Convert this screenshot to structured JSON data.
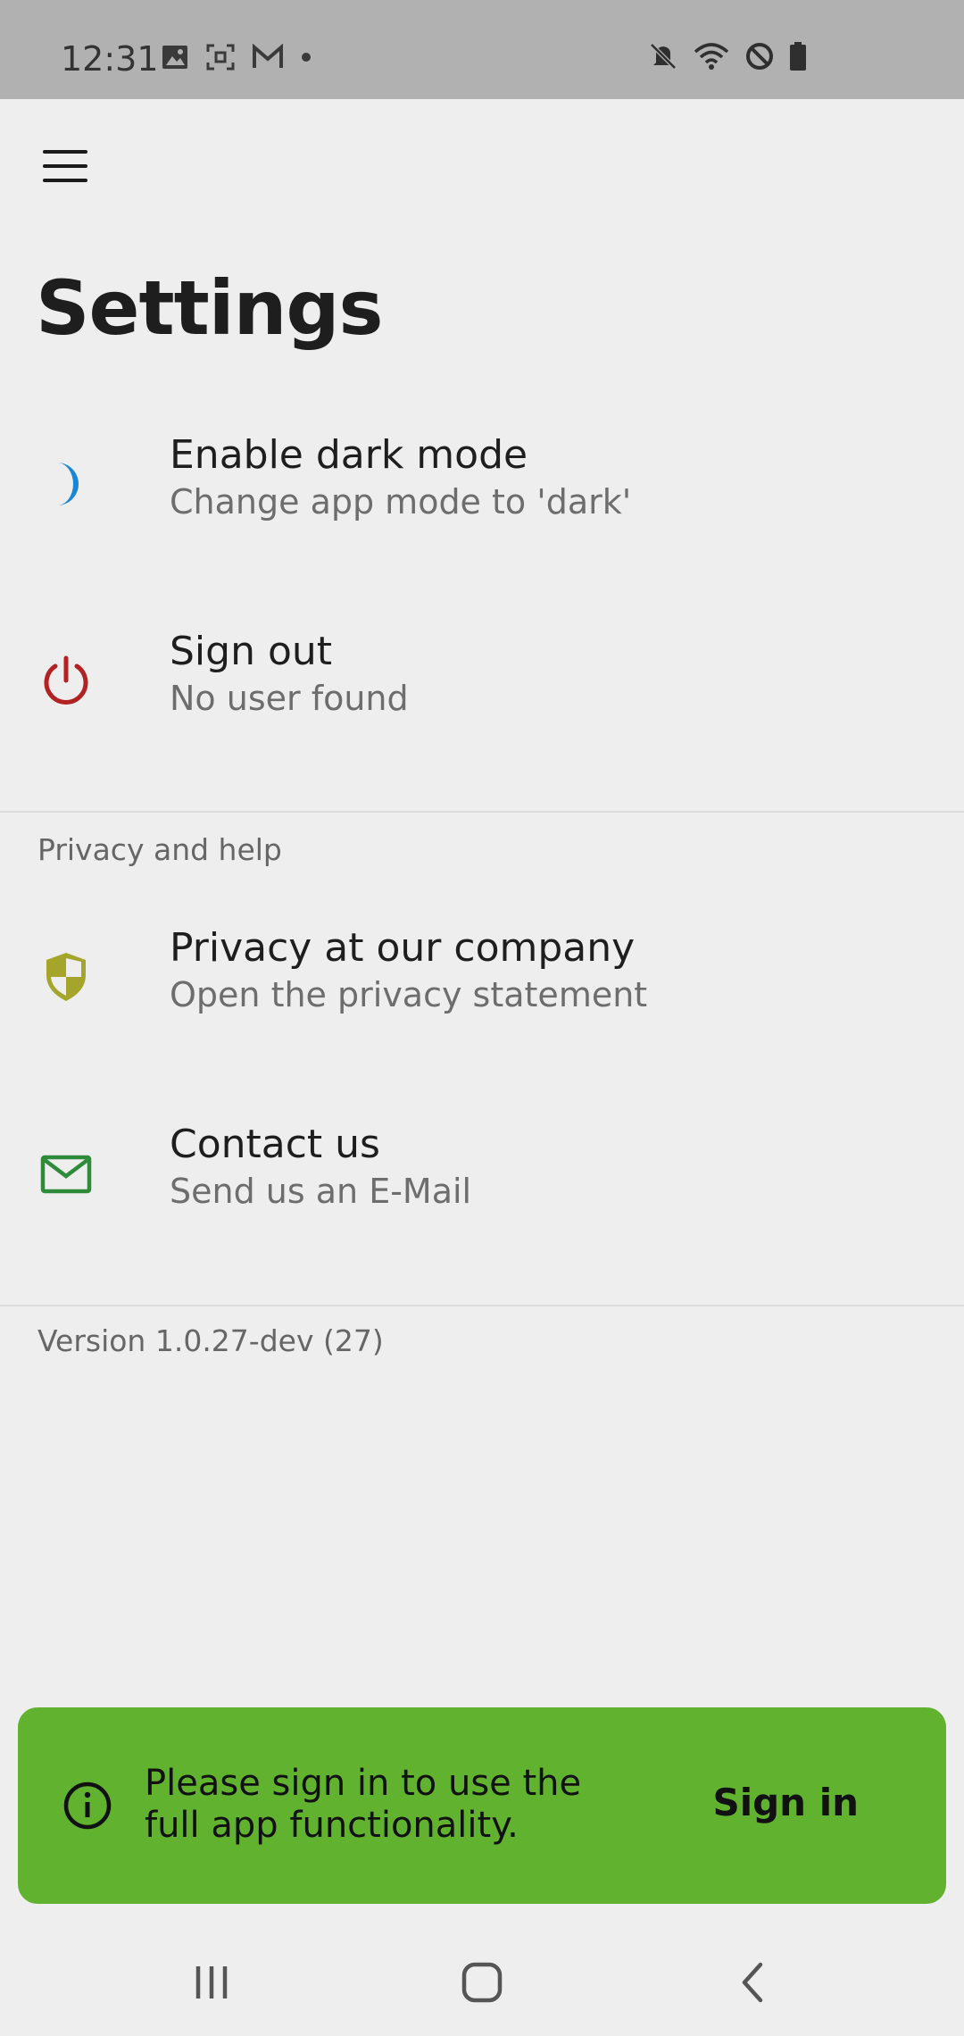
{
  "status_bar": {
    "time": "12:31",
    "left_icons": [
      "image-icon",
      "screenshot-icon",
      "gmail-icon",
      "dot-icon"
    ],
    "right_icons": [
      "mute-icon",
      "wifi-icon",
      "do-not-disturb-icon",
      "battery-icon"
    ]
  },
  "header": {
    "title": "Settings"
  },
  "settings_items": [
    {
      "title": "Enable dark mode",
      "subtitle": "Change app mode to 'dark'",
      "icon": "moon-icon",
      "icon_color": "#1a86d8"
    },
    {
      "title": "Sign out",
      "subtitle": "No user found",
      "icon": "power-icon",
      "icon_color": "#b22222"
    }
  ],
  "section": {
    "label": "Privacy and help"
  },
  "help_items": [
    {
      "title": "Privacy at our company",
      "subtitle": "Open the privacy statement",
      "icon": "shield-icon",
      "icon_color": "#a4a52a"
    },
    {
      "title": "Contact us",
      "subtitle": "Send us an E-Mail",
      "icon": "mail-icon",
      "icon_color": "#2e8b3a"
    }
  ],
  "version": "Version 1.0.27-dev (27)",
  "snackbar": {
    "message": "Please sign in to use the full app functionality.",
    "action": "Sign in",
    "icon": "info-icon",
    "background": "#61b22f"
  },
  "nav_bar": {
    "buttons": [
      "recents-icon",
      "home-icon",
      "back-icon"
    ]
  }
}
